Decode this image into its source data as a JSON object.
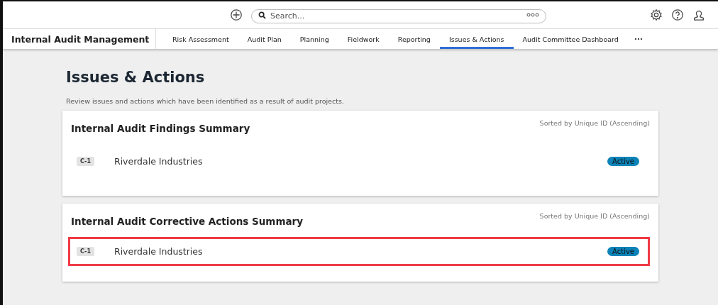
{
  "top_bar": {
    "search": {
      "placeholder": "Search..."
    }
  },
  "nav": {
    "app_name": "Internal Audit Management",
    "tabs": [
      {
        "label": "Risk Assessment",
        "selected": false
      },
      {
        "label": "Audit Plan",
        "selected": false
      },
      {
        "label": "Planning",
        "selected": false
      },
      {
        "label": "Fieldwork",
        "selected": false
      },
      {
        "label": "Reporting",
        "selected": false
      },
      {
        "label": "Issues & Actions",
        "selected": true
      },
      {
        "label": "Audit Committee Dashboard",
        "selected": false
      }
    ]
  },
  "page": {
    "title": "Issues & Actions",
    "description": "Review issues and actions which have been identified as a result of audit projects."
  },
  "cards": [
    {
      "title": "Internal Audit Findings Summary",
      "sort_note": "Sorted by Unique ID (Ascending)",
      "rows": [
        {
          "id": "C-1",
          "name": "Riverdale Industries",
          "status": "Active",
          "highlighted": false
        }
      ]
    },
    {
      "title": "Internal Audit Corrective Actions Summary",
      "sort_note": "Sorted by Unique ID (Ascending)",
      "rows": [
        {
          "id": "C-1",
          "name": "Riverdale Industries",
          "status": "Active",
          "highlighted": true
        }
      ]
    }
  ]
}
